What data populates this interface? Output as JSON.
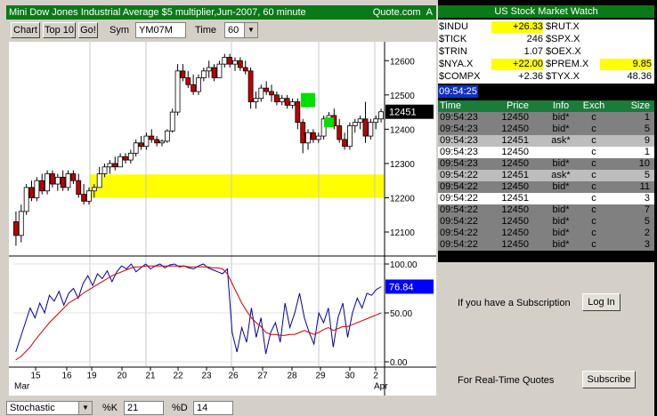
{
  "chart_header": {
    "title": "Mini Dow Jones Industrial Average $5 multiplier,Jun-2007, 60 minute",
    "source": "Quote.com",
    "source_flag": "A"
  },
  "toolbar": {
    "chart_label": "Chart",
    "top10_label": "Top 10",
    "go_label": "Go!",
    "sym_label": "Sym",
    "sym_value": "YM07M",
    "time_label": "Time",
    "time_value": "60"
  },
  "bottom_bar": {
    "study_value": "Stochastic",
    "k_label": "%K",
    "k_value": "21",
    "d_label": "%D",
    "d_value": "14"
  },
  "colors": {
    "up_candle": "#ffffff",
    "down_candle": "#c00000",
    "support_zone": "#ffff00",
    "marker": "#00e000",
    "k_line": "#0000a0",
    "d_line": "#d00000",
    "price_badge": "#000000",
    "stoch_badge": "#0000ff"
  },
  "chart_data": [
    {
      "type": "candlestick",
      "price_axis": {
        "ticks": [
          "12600",
          "12500",
          "12400",
          "12300",
          "12200",
          "12100"
        ]
      },
      "current_price": "12451",
      "x_ticks": [
        "15",
        "16",
        "19",
        "20",
        "21",
        "22",
        "23",
        "26",
        "27",
        "28",
        "29",
        "30",
        "2"
      ],
      "month_labels": [
        "Mar",
        "Apr"
      ],
      "ylim": [
        12030,
        12650
      ],
      "support_zone": [
        12200,
        12268
      ],
      "candles": [
        {
          "o": 12130,
          "h": 12160,
          "l": 12060,
          "c": 12090
        },
        {
          "o": 12090,
          "h": 12180,
          "l": 12070,
          "c": 12160
        },
        {
          "o": 12160,
          "h": 12240,
          "l": 12150,
          "c": 12230
        },
        {
          "o": 12230,
          "h": 12250,
          "l": 12190,
          "c": 12200
        },
        {
          "o": 12200,
          "h": 12260,
          "l": 12190,
          "c": 12250
        },
        {
          "o": 12250,
          "h": 12270,
          "l": 12210,
          "c": 12220
        },
        {
          "o": 12220,
          "h": 12280,
          "l": 12210,
          "c": 12270
        },
        {
          "o": 12270,
          "h": 12280,
          "l": 12230,
          "c": 12240
        },
        {
          "o": 12240,
          "h": 12270,
          "l": 12220,
          "c": 12260
        },
        {
          "o": 12260,
          "h": 12280,
          "l": 12220,
          "c": 12230
        },
        {
          "o": 12230,
          "h": 12280,
          "l": 12220,
          "c": 12270
        },
        {
          "o": 12270,
          "h": 12280,
          "l": 12240,
          "c": 12250
        },
        {
          "o": 12250,
          "h": 12270,
          "l": 12200,
          "c": 12210
        },
        {
          "o": 12210,
          "h": 12240,
          "l": 12180,
          "c": 12190
        },
        {
          "o": 12190,
          "h": 12230,
          "l": 12180,
          "c": 12220
        },
        {
          "o": 12220,
          "h": 12240,
          "l": 12200,
          "c": 12230
        },
        {
          "o": 12230,
          "h": 12290,
          "l": 12230,
          "c": 12270
        },
        {
          "o": 12270,
          "h": 12300,
          "l": 12260,
          "c": 12290
        },
        {
          "o": 12290,
          "h": 12310,
          "l": 12270,
          "c": 12300
        },
        {
          "o": 12300,
          "h": 12320,
          "l": 12280,
          "c": 12290
        },
        {
          "o": 12290,
          "h": 12330,
          "l": 12290,
          "c": 12320
        },
        {
          "o": 12320,
          "h": 12330,
          "l": 12300,
          "c": 12310
        },
        {
          "o": 12310,
          "h": 12340,
          "l": 12300,
          "c": 12330
        },
        {
          "o": 12330,
          "h": 12370,
          "l": 12320,
          "c": 12360
        },
        {
          "o": 12360,
          "h": 12380,
          "l": 12340,
          "c": 12350
        },
        {
          "o": 12350,
          "h": 12390,
          "l": 12340,
          "c": 12380
        },
        {
          "o": 12380,
          "h": 12400,
          "l": 12360,
          "c": 12370
        },
        {
          "o": 12370,
          "h": 12380,
          "l": 12350,
          "c": 12360
        },
        {
          "o": 12360,
          "h": 12370,
          "l": 12350,
          "c": 12365
        },
        {
          "o": 12365,
          "h": 12400,
          "l": 12360,
          "c": 12395
        },
        {
          "o": 12395,
          "h": 12460,
          "l": 12390,
          "c": 12450
        },
        {
          "o": 12450,
          "h": 12590,
          "l": 12440,
          "c": 12570
        },
        {
          "o": 12570,
          "h": 12590,
          "l": 12540,
          "c": 12550
        },
        {
          "o": 12550,
          "h": 12570,
          "l": 12520,
          "c": 12530
        },
        {
          "o": 12530,
          "h": 12560,
          "l": 12500,
          "c": 12510
        },
        {
          "o": 12510,
          "h": 12560,
          "l": 12500,
          "c": 12550
        },
        {
          "o": 12550,
          "h": 12580,
          "l": 12540,
          "c": 12570
        },
        {
          "o": 12570,
          "h": 12600,
          "l": 12550,
          "c": 12580
        },
        {
          "o": 12580,
          "h": 12590,
          "l": 12540,
          "c": 12550
        },
        {
          "o": 12550,
          "h": 12600,
          "l": 12550,
          "c": 12590
        },
        {
          "o": 12590,
          "h": 12620,
          "l": 12580,
          "c": 12610
        },
        {
          "o": 12610,
          "h": 12620,
          "l": 12580,
          "c": 12590
        },
        {
          "o": 12590,
          "h": 12610,
          "l": 12570,
          "c": 12600
        },
        {
          "o": 12600,
          "h": 12610,
          "l": 12570,
          "c": 12580
        },
        {
          "o": 12580,
          "h": 12600,
          "l": 12560,
          "c": 12570
        },
        {
          "o": 12570,
          "h": 12580,
          "l": 12460,
          "c": 12480
        },
        {
          "o": 12480,
          "h": 12510,
          "l": 12460,
          "c": 12490
        },
        {
          "o": 12490,
          "h": 12530,
          "l": 12480,
          "c": 12520
        },
        {
          "o": 12520,
          "h": 12540,
          "l": 12500,
          "c": 12510
        },
        {
          "o": 12510,
          "h": 12530,
          "l": 12480,
          "c": 12500
        },
        {
          "o": 12500,
          "h": 12510,
          "l": 12470,
          "c": 12480
        },
        {
          "o": 12480,
          "h": 12500,
          "l": 12470,
          "c": 12490
        },
        {
          "o": 12490,
          "h": 12500,
          "l": 12460,
          "c": 12470
        },
        {
          "o": 12470,
          "h": 12490,
          "l": 12460,
          "c": 12480
        },
        {
          "o": 12480,
          "h": 12490,
          "l": 12400,
          "c": 12420
        },
        {
          "o": 12420,
          "h": 12430,
          "l": 12330,
          "c": 12360
        },
        {
          "o": 12360,
          "h": 12400,
          "l": 12340,
          "c": 12390
        },
        {
          "o": 12390,
          "h": 12400,
          "l": 12360,
          "c": 12370
        },
        {
          "o": 12370,
          "h": 12390,
          "l": 12360,
          "c": 12380
        },
        {
          "o": 12380,
          "h": 12440,
          "l": 12370,
          "c": 12430
        },
        {
          "o": 12430,
          "h": 12450,
          "l": 12410,
          "c": 12440
        },
        {
          "o": 12440,
          "h": 12460,
          "l": 12400,
          "c": 12410
        },
        {
          "o": 12410,
          "h": 12430,
          "l": 12360,
          "c": 12370
        },
        {
          "o": 12370,
          "h": 12390,
          "l": 12340,
          "c": 12350
        },
        {
          "o": 12350,
          "h": 12420,
          "l": 12340,
          "c": 12410
        },
        {
          "o": 12410,
          "h": 12430,
          "l": 12390,
          "c": 12420
        },
        {
          "o": 12420,
          "h": 12440,
          "l": 12400,
          "c": 12430
        },
        {
          "o": 12430,
          "h": 12480,
          "l": 12360,
          "c": 12380
        },
        {
          "o": 12380,
          "h": 12430,
          "l": 12370,
          "c": 12420
        },
        {
          "o": 12420,
          "h": 12440,
          "l": 12400,
          "c": 12430
        },
        {
          "o": 12430,
          "h": 12460,
          "l": 12420,
          "c": 12451
        }
      ],
      "markers": [
        {
          "index": 56,
          "y": 12485,
          "size": "large"
        },
        {
          "index": 60,
          "y": 12420,
          "size": "small"
        }
      ]
    },
    {
      "type": "line",
      "axis_ticks": [
        "100.00",
        "50.00",
        "0.00"
      ],
      "current_value": "76.84",
      "ylim": [
        0,
        100
      ],
      "series": [
        {
          "name": "%K",
          "values": [
            10,
            25,
            40,
            55,
            45,
            60,
            50,
            68,
            62,
            72,
            58,
            70,
            75,
            65,
            80,
            88,
            78,
            90,
            85,
            93,
            82,
            92,
            98,
            95,
            100,
            92,
            96,
            100,
            95,
            98,
            100,
            96,
            99,
            100,
            97,
            98,
            96,
            95,
            98,
            100,
            96,
            94,
            92,
            90,
            95,
            30,
            10,
            35,
            20,
            55,
            25,
            45,
            8,
            30,
            40,
            20,
            60,
            35,
            50,
            70,
            45,
            30,
            18,
            50,
            40,
            55,
            15,
            45,
            60,
            25,
            50,
            65,
            55,
            70,
            68,
            74,
            76.84
          ]
        },
        {
          "name": "%D",
          "values": [
            2,
            5,
            10,
            15,
            22,
            28,
            34,
            40,
            45,
            50,
            55,
            60,
            63,
            66,
            70,
            73,
            76,
            79,
            82,
            85,
            88,
            90,
            92,
            94,
            96,
            97,
            97,
            98,
            98,
            98,
            98,
            98,
            98,
            98,
            98,
            98,
            97,
            97,
            97,
            97,
            97,
            96,
            96,
            95,
            90,
            80,
            70,
            60,
            52,
            45,
            40,
            36,
            30,
            28,
            28,
            27,
            27,
            28,
            28,
            30,
            32,
            30,
            28,
            30,
            33,
            35,
            32,
            34,
            36,
            36,
            38,
            40,
            42,
            44,
            46,
            48,
            50
          ]
        }
      ]
    }
  ],
  "watch": {
    "title": "US Stock Market Watch",
    "left": [
      {
        "sym": "$INDU",
        "val": "+26.33",
        "hl": true
      },
      {
        "sym": "$TICK",
        "val": "246",
        "hl": false
      },
      {
        "sym": "$TRIN",
        "val": "1.07",
        "hl": false
      },
      {
        "sym": "$NYA.X",
        "val": "+22.00",
        "hl": true
      },
      {
        "sym": "$COMPX",
        "val": "+2.36",
        "hl": false
      }
    ],
    "right": [
      {
        "sym": "$RUT.X",
        "val": "",
        "hl": false
      },
      {
        "sym": "$SPX.X",
        "val": "",
        "hl": false
      },
      {
        "sym": "$OEX.X",
        "val": "",
        "hl": false
      },
      {
        "sym": "$PREM.X",
        "val": "9.85",
        "hl": true
      },
      {
        "sym": "$TYX.X",
        "val": "48.36",
        "hl": false
      }
    ]
  },
  "clock": "09:54:25",
  "trades": {
    "headers": [
      "Time",
      "Price",
      "Info",
      "Exch",
      "Size"
    ],
    "rows": [
      {
        "time": "09:54:23",
        "price": "12450",
        "info": "bid*",
        "exch": "c",
        "size": "1",
        "shade": "dark"
      },
      {
        "time": "09:54:23",
        "price": "12450",
        "info": "bid*",
        "exch": "c",
        "size": "5",
        "shade": "dark"
      },
      {
        "time": "09:54:23",
        "price": "12451",
        "info": "ask*",
        "exch": "c",
        "size": "9",
        "shade": "light"
      },
      {
        "time": "09:54:23",
        "price": "12450",
        "info": "",
        "exch": "c",
        "size": "1",
        "shade": "white"
      },
      {
        "time": "09:54:23",
        "price": "12450",
        "info": "bid*",
        "exch": "c",
        "size": "10",
        "shade": "dark"
      },
      {
        "time": "09:54:22",
        "price": "12451",
        "info": "ask*",
        "exch": "c",
        "size": "5",
        "shade": "light"
      },
      {
        "time": "09:54:22",
        "price": "12450",
        "info": "bid*",
        "exch": "c",
        "size": "11",
        "shade": "dark"
      },
      {
        "time": "09:54:22",
        "price": "12451",
        "info": "",
        "exch": "c",
        "size": "3",
        "shade": "white"
      },
      {
        "time": "09:54:22",
        "price": "12450",
        "info": "bid*",
        "exch": "c",
        "size": "7",
        "shade": "dark"
      },
      {
        "time": "09:54:22",
        "price": "12450",
        "info": "bid*",
        "exch": "c",
        "size": "5",
        "shade": "dark"
      },
      {
        "time": "09:54:22",
        "price": "12450",
        "info": "bid*",
        "exch": "c",
        "size": "2",
        "shade": "dark"
      },
      {
        "time": "09:54:22",
        "price": "12450",
        "info": "bid*",
        "exch": "c",
        "size": "3",
        "shade": "dark"
      }
    ]
  },
  "panel": {
    "subscription_text": "If you have a Subscription",
    "login_label": "Log In",
    "quotes_text": "For Real-Time Quotes",
    "subscribe_label": "Subscribe"
  }
}
